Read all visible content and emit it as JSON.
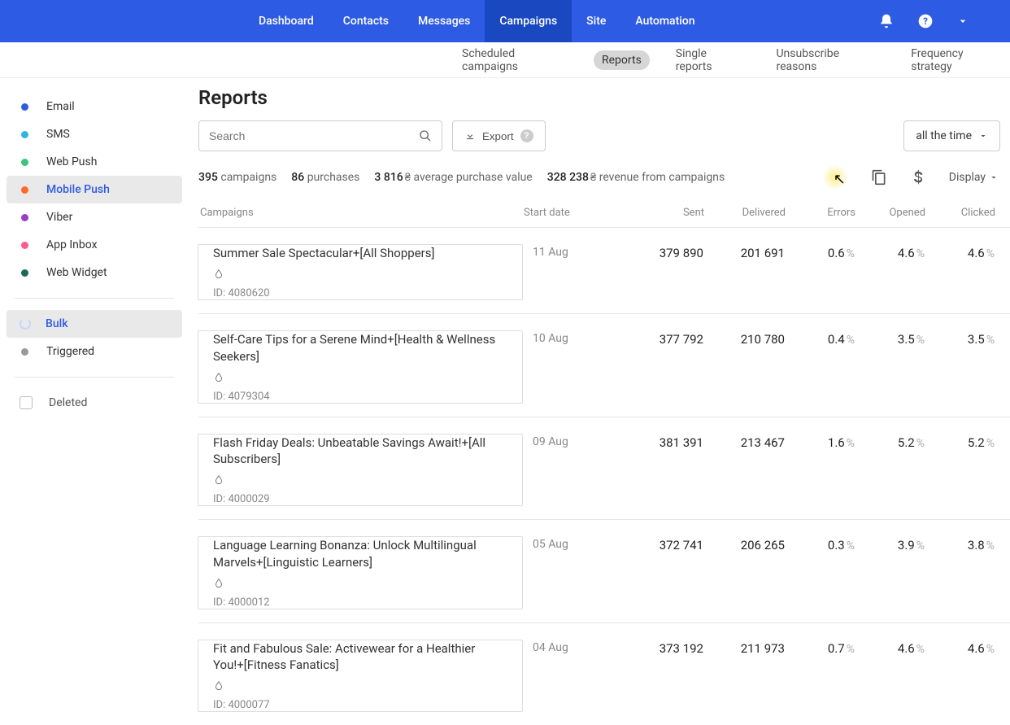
{
  "nav": {
    "items": [
      "Dashboard",
      "Contacts",
      "Messages",
      "Campaigns",
      "Site",
      "Automation"
    ],
    "active": "Campaigns"
  },
  "subnav": {
    "items": [
      "Scheduled campaigns",
      "Reports",
      "Single reports",
      "Unsubscribe reasons",
      "Frequency strategy"
    ],
    "active": "Reports"
  },
  "sidebar": {
    "channels": [
      {
        "label": "Email",
        "color": "#2d5be3"
      },
      {
        "label": "SMS",
        "color": "#2db6e3"
      },
      {
        "label": "Web Push",
        "color": "#3cc47c"
      },
      {
        "label": "Mobile Push",
        "color": "#ff6a2b",
        "active": true
      },
      {
        "label": "Viber",
        "color": "#9b3cc4"
      },
      {
        "label": "App Inbox",
        "color": "#ff5a8c"
      },
      {
        "label": "Web Widget",
        "color": "#1b6b5a"
      }
    ],
    "types": [
      {
        "label": "Bulk",
        "active": true,
        "spinner": true
      },
      {
        "label": "Triggered"
      }
    ],
    "deleted": "Deleted"
  },
  "page": {
    "title": "Reports",
    "search_placeholder": "Search",
    "export_label": "Export",
    "time_range": "all the time",
    "display_label": "Display"
  },
  "stats": {
    "campaigns_count": "395",
    "campaigns_label": "campaigns",
    "purchases_count": "86",
    "purchases_label": "purchases",
    "avg_value": "3 816",
    "avg_currency": "₴",
    "avg_label": "average purchase value",
    "revenue_value": "328 238",
    "revenue_currency": "₴",
    "revenue_label": "revenue from campaigns"
  },
  "columns": {
    "campaigns": "Campaigns",
    "start_date": "Start date",
    "sent": "Sent",
    "delivered": "Delivered",
    "errors": "Errors",
    "opened": "Opened",
    "clicked": "Clicked"
  },
  "rows": [
    {
      "title": "Summer Sale Spectacular+[All Shoppers]",
      "id": "ID: 4080620",
      "date": "11 Aug",
      "sent": "379 890",
      "delivered": "201 691",
      "errors": "0.6",
      "opened": "4.6",
      "clicked": "4.6"
    },
    {
      "title": "Self-Care Tips for a Serene Mind+[Health & Wellness Seekers]",
      "id": "ID: 4079304",
      "date": "10 Aug",
      "sent": "377 792",
      "delivered": "210 780",
      "errors": "0.4",
      "opened": "3.5",
      "clicked": "3.5"
    },
    {
      "title": "Flash Friday Deals: Unbeatable Savings Await!+[All Subscribers]",
      "id": "ID: 4000029",
      "date": "09 Aug",
      "sent": "381 391",
      "delivered": "213 467",
      "errors": "1.6",
      "opened": "5.2",
      "clicked": "5.2"
    },
    {
      "title": "Language Learning Bonanza: Unlock Multilingual Marvels+[Linguistic Learners]",
      "id": "ID: 4000012",
      "date": "05 Aug",
      "sent": "372 741",
      "delivered": "206 265",
      "errors": "0.3",
      "opened": "3.9",
      "clicked": "3.8"
    },
    {
      "title": "Fit and Fabulous Sale: Activewear for a Healthier You!+[Fitness Fanatics]",
      "id": "ID: 4000077",
      "date": "04 Aug",
      "sent": "373 192",
      "delivered": "211 973",
      "errors": "0.7",
      "opened": "4.6",
      "clicked": "4.6"
    }
  ],
  "percent_unit": "%"
}
